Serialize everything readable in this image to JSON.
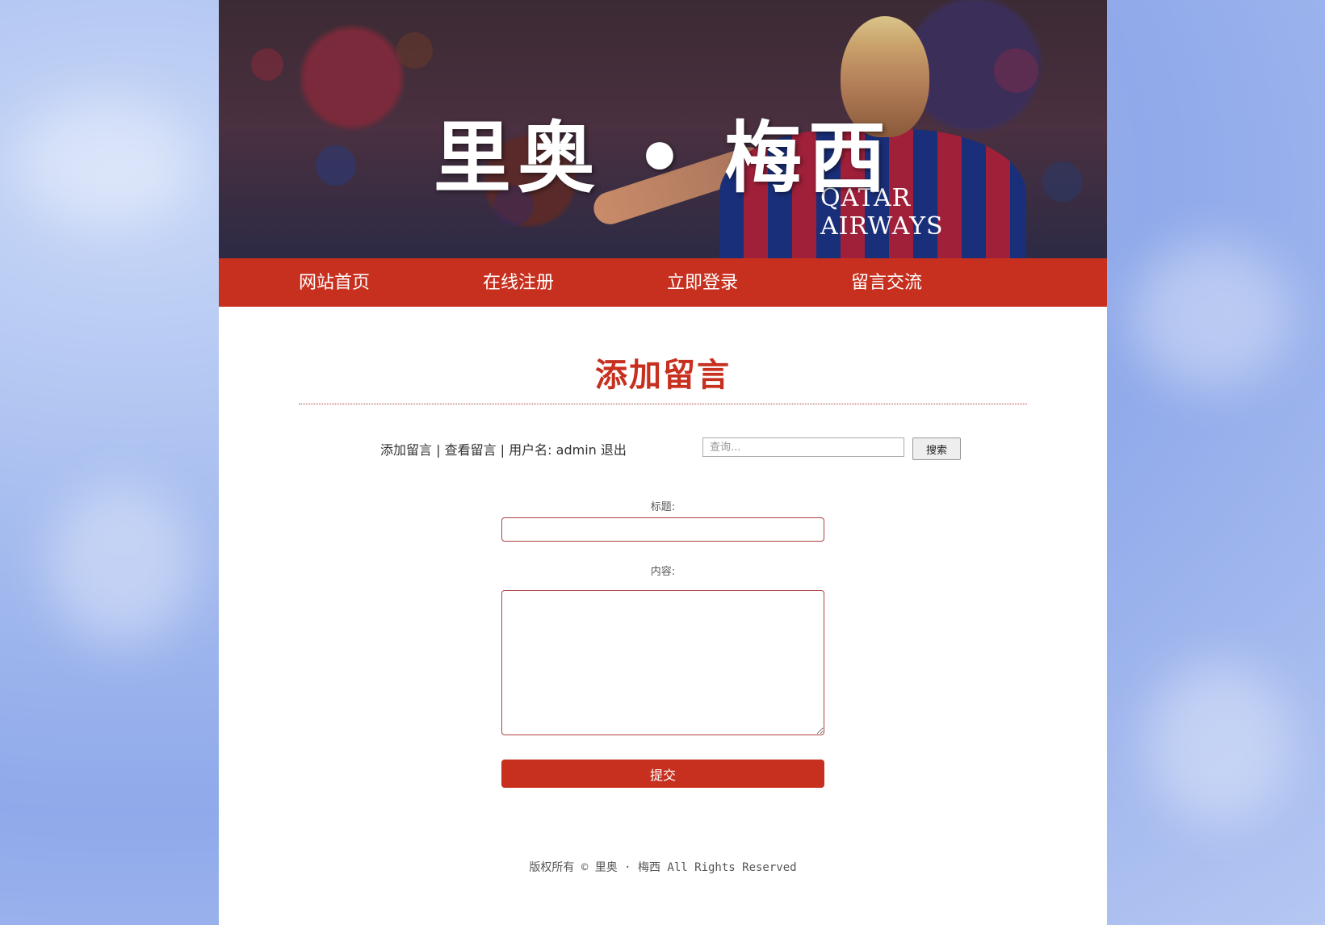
{
  "banner": {
    "title": "里奥 • 梅西",
    "sponsor": "QATAR AIRWAYS"
  },
  "nav": {
    "items": [
      {
        "label": "网站首页"
      },
      {
        "label": "在线注册"
      },
      {
        "label": "立即登录"
      },
      {
        "label": "留言交流"
      }
    ]
  },
  "section": {
    "title": "添加留言"
  },
  "links": {
    "add": "添加留言",
    "sep1": " | ",
    "view": "查看留言",
    "sep2": " | ",
    "user_prefix": "用户名:",
    "username": "admin",
    "logout": "退出"
  },
  "search": {
    "placeholder": "查询...",
    "button": "搜索"
  },
  "form": {
    "title_label": "标题:",
    "content_label": "内容:",
    "submit": "提交"
  },
  "footer": {
    "text": "版权所有 © 里奥 · 梅西 All Rights Reserved"
  },
  "colors": {
    "accent": "#c7301f",
    "background": "#a9bff0"
  }
}
